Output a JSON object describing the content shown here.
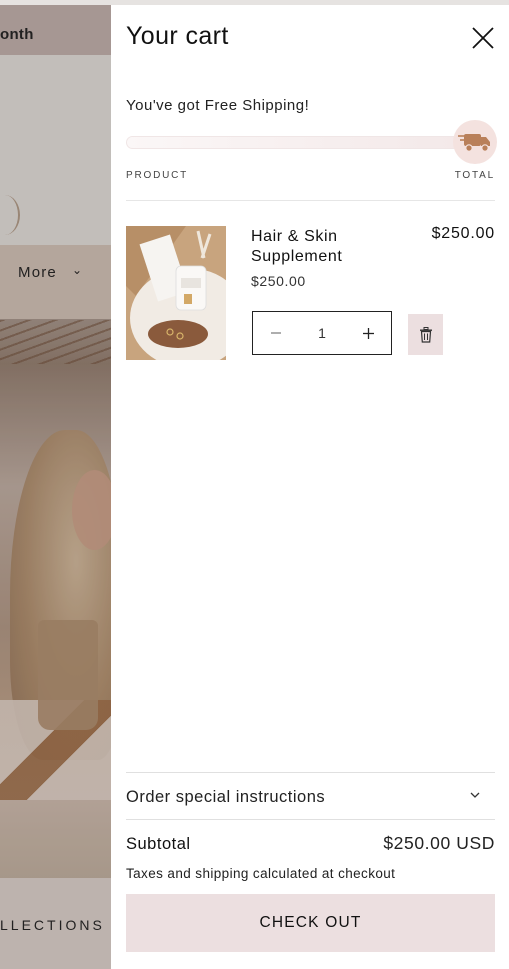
{
  "background_page": {
    "header_partial_text": "onth",
    "nav_more_label": "More",
    "footer_partial_text": "LLECTIONS"
  },
  "cart": {
    "title": "Your cart",
    "shipping_message": "You've got Free Shipping!",
    "shipping_progress": 1.0,
    "columns": {
      "product": "PRODUCT",
      "total": "TOTAL"
    },
    "items": [
      {
        "name": "Hair & Skin Supplement",
        "unit_price": "$250.00",
        "line_total": "$250.00",
        "quantity": "1"
      }
    ],
    "instructions_label": "Order special instructions",
    "subtotal_label": "Subtotal",
    "subtotal_value": "$250.00 USD",
    "tax_note": "Taxes and shipping calculated at checkout",
    "checkout_label": "CHECK OUT"
  },
  "icons": {
    "close": "close-icon",
    "truck": "truck-icon",
    "minus": "minus-icon",
    "plus": "plus-icon",
    "remove": "trash-icon",
    "chevron": "chevron-down-icon"
  },
  "colors": {
    "accent_bg": "#ecdfe0",
    "truck": "#b9805a",
    "progress_track": "#f6eeee"
  }
}
